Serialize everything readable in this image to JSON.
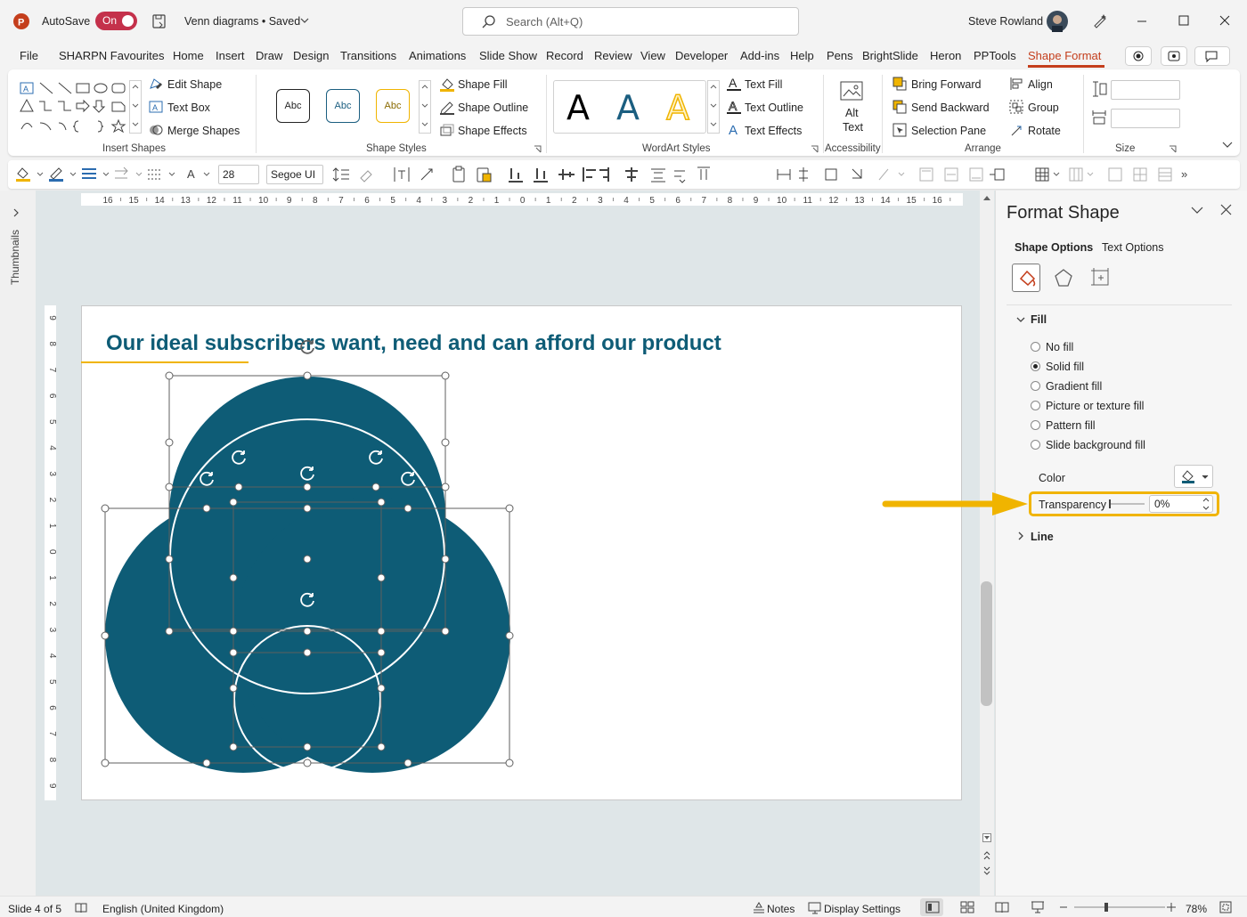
{
  "app": {
    "autosave_label": "AutoSave",
    "autosave_state": "On",
    "doc_title": "Venn diagrams • Saved",
    "search_placeholder": "Search (Alt+Q)",
    "user_name": "Steve Rowland",
    "accent_color": "#c43e1c",
    "highlight_color": "#f0b400"
  },
  "tabs": [
    "File",
    "SHARPN Favourites",
    "Home",
    "Insert",
    "Draw",
    "Design",
    "Transitions",
    "Animations",
    "Slide Show",
    "Record",
    "Review",
    "View",
    "Developer",
    "Add-ins",
    "Help",
    "Pens",
    "BrightSlide",
    "Heron",
    "PPTools",
    "Shape Format"
  ],
  "active_tab": "Shape Format",
  "ribbon": {
    "insert_shapes": {
      "label": "Insert Shapes",
      "edit_shape": "Edit Shape",
      "text_box": "Text Box",
      "merge_shapes": "Merge Shapes"
    },
    "shape_styles": {
      "label": "Shape Styles",
      "style_sample": "Abc",
      "shape_fill": "Shape Fill",
      "shape_outline": "Shape Outline",
      "shape_effects": "Shape Effects"
    },
    "wordart_styles": {
      "label": "WordArt Styles",
      "sample": "A",
      "text_fill": "Text Fill",
      "text_outline": "Text Outline",
      "text_effects": "Text Effects"
    },
    "accessibility": {
      "label": "Accessibility",
      "alt_text_line1": "Alt",
      "alt_text_line2": "Text"
    },
    "arrange": {
      "label": "Arrange",
      "bring_forward": "Bring Forward",
      "send_backward": "Send Backward",
      "selection_pane": "Selection Pane",
      "align": "Align",
      "group": "Group",
      "rotate": "Rotate"
    },
    "size": {
      "label": "Size"
    }
  },
  "format_toolbar": {
    "font_size": "28",
    "font_name": "Segoe UI"
  },
  "left_panel": {
    "thumbnails_label": "Thumbnails"
  },
  "ruler": {
    "h_labels": [
      "16",
      "15",
      "14",
      "13",
      "12",
      "11",
      "10",
      "9",
      "8",
      "7",
      "6",
      "5",
      "4",
      "3",
      "2",
      "1",
      "0",
      "1",
      "2",
      "3",
      "4",
      "5",
      "6",
      "7",
      "8",
      "9",
      "10",
      "11",
      "12",
      "13",
      "14",
      "15",
      "16"
    ],
    "v_labels": [
      "9",
      "8",
      "7",
      "6",
      "5",
      "4",
      "3",
      "2",
      "1",
      "0",
      "1",
      "2",
      "3",
      "4",
      "5",
      "6",
      "7",
      "8",
      "9"
    ]
  },
  "slide": {
    "title": "Our ideal subscribers want, need and can afford our product",
    "circle_color": "#0e5c76",
    "title_underline_color": "#f0b400"
  },
  "format_pane": {
    "title": "Format Shape",
    "tab_shape_options": "Shape Options",
    "tab_text_options": "Text Options",
    "fill_section": "Fill",
    "fill_options": [
      "No fill",
      "Solid fill",
      "Gradient fill",
      "Picture or texture fill",
      "Pattern fill",
      "Slide background fill"
    ],
    "selected_fill": "Solid fill",
    "color_label": "Color",
    "transparency_label": "Transparency",
    "transparency_value": "0%",
    "line_section": "Line"
  },
  "status": {
    "slide_info": "Slide 4 of 5",
    "language": "English (United Kingdom)",
    "notes": "Notes",
    "display_settings": "Display Settings",
    "zoom": "78%"
  }
}
